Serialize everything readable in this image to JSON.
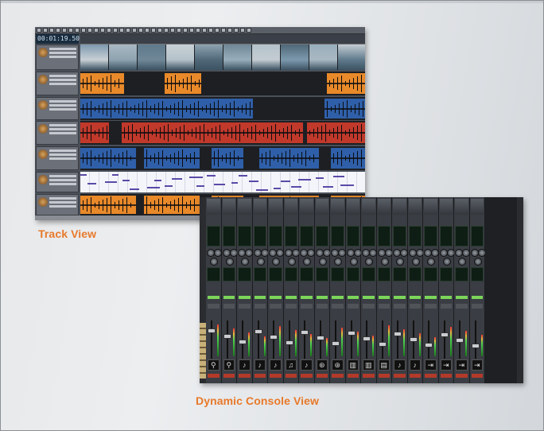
{
  "captions": {
    "track_view": "Track View",
    "console_view": "Dynamic Console View"
  },
  "track_view": {
    "timecode": "00:01:19.501",
    "lanes": [
      {
        "kind": "video",
        "color": "#8fa8b8"
      },
      {
        "kind": "audio",
        "color": "#e8892a"
      },
      {
        "kind": "audio",
        "color": "#2f5fa8"
      },
      {
        "kind": "audio",
        "color": "#c0392b"
      },
      {
        "kind": "audio",
        "color": "#2f5fa8"
      },
      {
        "kind": "midi",
        "color": "#e8eaf4"
      },
      {
        "kind": "audio",
        "color": "#e8892a"
      }
    ]
  },
  "console_view": {
    "channel_count": 18,
    "accent": "#e8792a",
    "icons": [
      "mic-icon",
      "mic-icon",
      "guitar-icon",
      "guitar-icon",
      "guitar-icon",
      "bass-icon",
      "guitar-icon",
      "drums-icon",
      "drums-icon",
      "piano-icon",
      "piano-icon",
      "synth-icon",
      "guitar-icon",
      "guitar-icon",
      "bus-icon",
      "bus-icon",
      "bus-icon",
      "bus-icon"
    ]
  }
}
